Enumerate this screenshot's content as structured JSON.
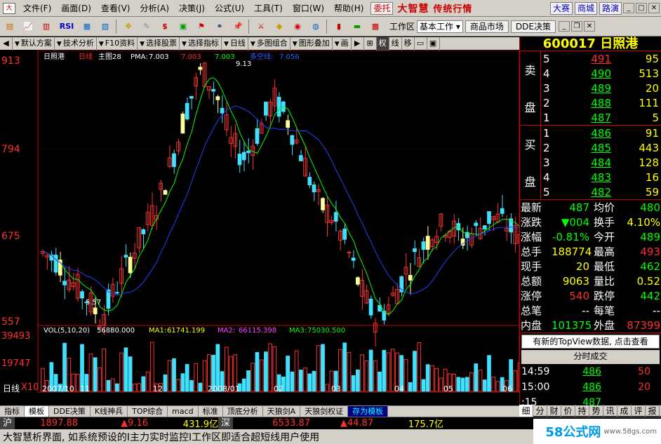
{
  "menu": {
    "items": [
      "文件(F)",
      "画面(D)",
      "查看(V)",
      "分析(A)",
      "决策(J)",
      "公式(U)",
      "工具(T)",
      "窗口(W)",
      "帮助(H)"
    ],
    "delegate_btn": "委托",
    "brand": "大智慧",
    "brand_sub": "传统行情",
    "top_links": [
      "大赛",
      "商城",
      "路演"
    ]
  },
  "toolbar": {
    "icons": [
      "open-icon",
      "chart-icon",
      "bars-icon",
      "rsi-icon",
      "f10-icon",
      "f11-icon",
      "cross-icon",
      "ruler-icon",
      "dollar-icon",
      "monitor-icon",
      "flag-icon",
      "binoculars-icon",
      "pin-icon",
      "sword-icon",
      "diamond-icon",
      "disc-icon",
      "globe-icon",
      "book-icon",
      "money-icon",
      "calc-icon"
    ],
    "rsi": "RSI",
    "workspace_label": "工作区",
    "workspace_value": "基本工作",
    "market_btn": "商品市场",
    "dde_btn": "DDE决策"
  },
  "tabs": [
    "默认方案",
    "技术分析",
    "F10资料",
    "选择股票",
    "选择指标",
    "日线",
    "多图组合",
    "图形叠加",
    "画",
    "权",
    "线",
    "移"
  ],
  "chart": {
    "stock_name": "日照港",
    "period": "日线",
    "main_label": "主图28",
    "pma_label": "PMA:",
    "pma_values": [
      "7.003",
      "7.003",
      "7.003"
    ],
    "kline_label": "多空线:",
    "kline_value": "7.056",
    "y_ticks": [
      "913",
      "794",
      "675",
      "557"
    ],
    "high_marker": "9.13",
    "low_marker": "5.57",
    "vol_label": "VOL(5,10,20)",
    "vol_value": "56880.000",
    "ma1_label": "MA1:",
    "ma1_value": "61741.199",
    "ma2_label": "MA2:",
    "ma2_value": "66115.398",
    "ma3_label": "MA3:",
    "ma3_value": "75030.500",
    "vol_ticks": [
      "39493",
      "19747",
      "X10"
    ],
    "x_labels": [
      "2007/10",
      "11",
      "12",
      "2008/01",
      "02",
      "03",
      "04",
      "05",
      "06"
    ],
    "period_bottom": "日线"
  },
  "bottom_tabs": [
    "指标",
    "模板",
    "DDE决策",
    "K线神兵",
    "TOP综合",
    "macd",
    "标准",
    "顶底分析",
    "天狼剑A",
    "天狼剑权证",
    "存为模板"
  ],
  "sidebar": {
    "code_name": "600017 日照港",
    "sell_label": [
      "卖",
      "盘"
    ],
    "buy_label": [
      "买",
      "盘"
    ],
    "sell": [
      {
        "lv": "5",
        "p": "491",
        "v": "95",
        "c": "#ff3030"
      },
      {
        "lv": "4",
        "p": "490",
        "v": "513",
        "c": "#00ff00"
      },
      {
        "lv": "3",
        "p": "489",
        "v": "20",
        "c": "#00ff00"
      },
      {
        "lv": "2",
        "p": "488",
        "v": "111",
        "c": "#00ff00"
      },
      {
        "lv": "1",
        "p": "487",
        "v": "5",
        "c": "#00ff00"
      }
    ],
    "buy": [
      {
        "lv": "1",
        "p": "486",
        "v": "91",
        "c": "#00ff00"
      },
      {
        "lv": "2",
        "p": "485",
        "v": "443",
        "c": "#00ff00"
      },
      {
        "lv": "3",
        "p": "484",
        "v": "128",
        "c": "#00ff00"
      },
      {
        "lv": "4",
        "p": "483",
        "v": "16",
        "c": "#00ff00"
      },
      {
        "lv": "5",
        "p": "482",
        "v": "59",
        "c": "#00ff00"
      }
    ],
    "stats": [
      {
        "k": "最新",
        "v": "487",
        "vc": "#00ff00",
        "k2": "均价",
        "v2": "480",
        "v2c": "#00ff00"
      },
      {
        "k": "涨跌",
        "v": "▼004",
        "vc": "#00ff00",
        "k2": "换手",
        "v2": "4.10%",
        "v2c": "#ffff00"
      },
      {
        "k": "涨幅",
        "v": "-0.81%",
        "vc": "#00ff00",
        "k2": "今开",
        "v2": "489",
        "v2c": "#00ff00"
      },
      {
        "k": "总手",
        "v": "188774",
        "vc": "#ffff00",
        "k2": "最高",
        "v2": "493",
        "v2c": "#ff3030"
      },
      {
        "k": "现手",
        "v": "20",
        "vc": "#ffff00",
        "k2": "最低",
        "v2": "462",
        "v2c": "#00ff00"
      },
      {
        "k": "总额",
        "v": "9063",
        "vc": "#ffff00",
        "k2": "量比",
        "v2": "0.52",
        "v2c": "#ffff00"
      },
      {
        "k": "涨停",
        "v": "540",
        "vc": "#ff3030",
        "k2": "跌停",
        "v2": "442",
        "v2c": "#00ff00"
      },
      {
        "k": "总笔",
        "v": "--",
        "vc": "#ffffff",
        "k2": "每笔",
        "v2": "--",
        "v2c": "#ffffff"
      },
      {
        "k": "内盘",
        "v": "101375",
        "vc": "#00ff00",
        "k2": "外盘",
        "v2": "87399",
        "v2c": "#ff3030"
      }
    ],
    "topview_btn": "有新的TopView数据, 点击查看",
    "fs_head": "分时成交",
    "fs_rows": [
      {
        "t": "14:59",
        "p": "486",
        "q": "50"
      },
      {
        "t": "15:00",
        "p": "486",
        "q": "20"
      },
      {
        "t": ":15",
        "p": "487",
        "q": ""
      }
    ],
    "side_tabs": [
      "细",
      "分",
      "财",
      "价",
      "持",
      "势",
      "讯",
      "成",
      "评",
      "报"
    ]
  },
  "status": {
    "sh_label": "沪",
    "sh_index": "1897.88",
    "sh_change": "▲9.16",
    "sh_amount": "431.9亿",
    "sz_label": "深",
    "sz_index": "6533.87",
    "sz_change": "▲44.87",
    "sz_amount": "175.7亿"
  },
  "news": "大智慧析界面, 如系统预设的I主力实时监控I工作区即适合超短线用户使用",
  "watermark": {
    "logo": "58公式网",
    "url": "www.58gs.com"
  }
}
